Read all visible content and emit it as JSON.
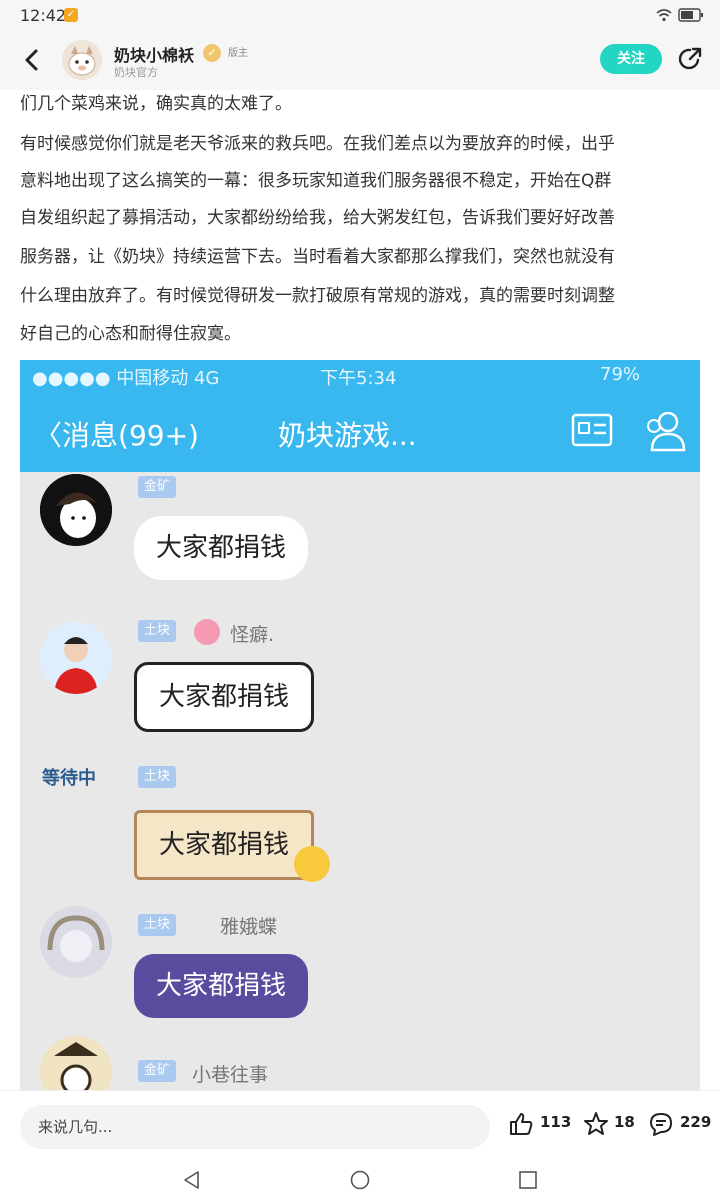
{
  "status_bar": {
    "time": "12:42",
    "app_badge": "✓"
  },
  "header": {
    "author_name": "奶块小棉袄",
    "role_tag": "版主",
    "author_sub": "奶块官方",
    "follow_label": "关注"
  },
  "article": {
    "lines": [
      "们几个菜鸡来说，确实真的太难了。",
      "有时候感觉你们就是老天爷派来的救兵吧。在我们差点以为要放弃的时候，出乎",
      "意料地出现了这么搞笑的一幕：很多玩家知道我们服务器很不稳定，开始在Q群",
      "自发组织起了募捐活动，大家都纷纷给我，给大粥发红包，告诉我们要好好改善",
      "服务器，让《奶块》持续运营下去。当时看着大家都那么撑我们，突然也就没有",
      "什么理由放弃了。有时候觉得研发一款打破原有常规的游戏，真的需要时刻调整",
      "好自己的心态和耐得住寂寞。"
    ]
  },
  "embedded": {
    "carrier": "●●●●● 中国移动  4G",
    "time": "下午5:34",
    "battery": "79%",
    "back_label": "消息(99+)",
    "title": "奶块游戏...",
    "messages": [
      {
        "tag": "金矿",
        "name": "",
        "text": "大家都捐钱"
      },
      {
        "tag": "土块",
        "name": "怪癖.",
        "text": "大家都捐钱"
      },
      {
        "tag": "土块",
        "name": "",
        "text": "大家都捐钱"
      },
      {
        "tag": "土块",
        "name": "雅娥蝶",
        "text": "大家都捐钱"
      },
      {
        "tag": "金矿",
        "name": "小巷往事",
        "text": ""
      }
    ],
    "avatar_text": "等待中"
  },
  "bottom_bar": {
    "comment_placeholder": "来说几句...",
    "likes": "113",
    "favorites": "18",
    "comments": "229"
  },
  "colors": {
    "accent": "#23d5c3",
    "qq_blue": "#38b8ee"
  }
}
